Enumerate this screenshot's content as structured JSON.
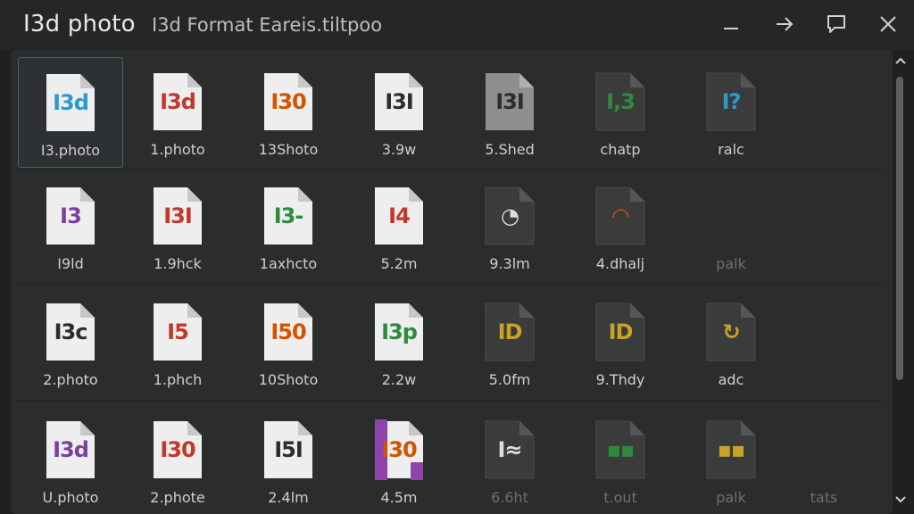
{
  "window": {
    "title": "I3d photo",
    "subtitle": "I3d Format Eareis.tiltpoo"
  },
  "colors": {
    "blue": "#2b9ad1",
    "red": "#c0392b",
    "orange": "#d35400",
    "green": "#2e8b3d",
    "purple": "#7b3fa0",
    "gold": "#c9a227",
    "dark": "#2d2d2d"
  },
  "rows": [
    [
      {
        "icon": "i3d-doc-icon",
        "glyph": "I3d",
        "color": "#2b9ad1",
        "style": "white",
        "label": "I3.photo"
      },
      {
        "icon": "i3d-doc-icon",
        "glyph": "I3d",
        "color": "#c0392b",
        "style": "white",
        "label": "1.photo"
      },
      {
        "icon": "i3d-doc-icon",
        "glyph": "I30",
        "color": "#d35400",
        "style": "white",
        "label": "13Shoto"
      },
      {
        "icon": "i3d-doc-icon",
        "glyph": "I3I",
        "color": "#2d2d2d",
        "style": "white",
        "label": "3.9w"
      },
      {
        "icon": "i3d-doc-icon",
        "glyph": "I3I",
        "color": "#2d2d2d",
        "style": "grey",
        "label": "5.Shed"
      },
      {
        "icon": "i3d-doc-icon",
        "glyph": "I,3",
        "color": "#2e8b3d",
        "style": "dark",
        "label": "chatp"
      },
      {
        "icon": "i3d-doc-icon",
        "glyph": "I?",
        "color": "#2b9ad1",
        "style": "dark",
        "label": "ralc"
      }
    ],
    [
      {
        "icon": "i3d-doc-icon",
        "glyph": "I3",
        "color": "#7b3fa0",
        "style": "white",
        "label": "I9ld"
      },
      {
        "icon": "i3d-doc-icon",
        "glyph": "I3I",
        "color": "#c0392b",
        "style": "white",
        "label": "1.9hck"
      },
      {
        "icon": "i3d-doc-icon",
        "glyph": "I3-",
        "color": "#2e8b3d",
        "style": "white",
        "label": "1axhcto"
      },
      {
        "icon": "i3d-doc-icon",
        "glyph": "I4",
        "color": "#c0392b",
        "style": "white",
        "label": "5.2m"
      },
      {
        "icon": "i3d-doc-icon",
        "glyph": "◔",
        "color": "#dddddd",
        "style": "dark",
        "label": "9.3lm"
      },
      {
        "icon": "i3d-doc-icon",
        "glyph": "◠",
        "color": "#d35400",
        "style": "dark",
        "label": "4.dhalj"
      },
      {
        "icon": "i3d-doc-icon",
        "glyph": "",
        "color": "#444444",
        "style": "none",
        "label": "palk"
      }
    ],
    [
      {
        "icon": "i3d-doc-icon",
        "glyph": "I3c",
        "color": "#2d2d2d",
        "style": "white",
        "label": "2.photo"
      },
      {
        "icon": "i3d-doc-icon",
        "glyph": "I5",
        "color": "#c0392b",
        "style": "white",
        "label": "1.phch"
      },
      {
        "icon": "i3d-doc-icon",
        "glyph": "I50",
        "color": "#d35400",
        "style": "white",
        "label": "10Shoto"
      },
      {
        "icon": "i3d-doc-icon",
        "glyph": "I3p",
        "color": "#2e8b3d",
        "style": "white",
        "label": "2.2w"
      },
      {
        "icon": "i3d-doc-icon",
        "glyph": "ID",
        "color": "#c9a227",
        "style": "dark",
        "label": "5.0fm"
      },
      {
        "icon": "i3d-doc-icon",
        "glyph": "ID",
        "color": "#c9a227",
        "style": "dark",
        "label": "9.Thdy"
      },
      {
        "icon": "i3d-doc-icon",
        "glyph": "↻",
        "color": "#c9a227",
        "style": "dark",
        "label": "adc"
      }
    ],
    [
      {
        "icon": "i3d-doc-icon",
        "glyph": "I3d",
        "color": "#7b3fa0",
        "style": "white",
        "label": "U.photo"
      },
      {
        "icon": "i3d-doc-icon",
        "glyph": "I30",
        "color": "#c0392b",
        "style": "white",
        "label": "2.phote"
      },
      {
        "icon": "i3d-doc-icon",
        "glyph": "I5I",
        "color": "#2d2d2d",
        "style": "white",
        "label": "2.4lm"
      },
      {
        "icon": "i3d-doc-icon",
        "glyph": "I30",
        "color": "#d35400",
        "style": "purple",
        "label": "4.5m"
      },
      {
        "icon": "i3d-doc-icon",
        "glyph": "I≈",
        "color": "#dddddd",
        "style": "dark",
        "label": "6.6ht"
      },
      {
        "icon": "i3d-doc-icon",
        "glyph": "▪▪",
        "color": "#2e8b3d",
        "style": "dark",
        "label": "t.out"
      },
      {
        "icon": "i3d-doc-icon",
        "glyph": "▪▪",
        "color": "#c9a227",
        "style": "dark",
        "label": "palk"
      },
      {
        "icon": "",
        "glyph": "",
        "color": "#444444",
        "style": "none",
        "label": "tats"
      }
    ]
  ]
}
